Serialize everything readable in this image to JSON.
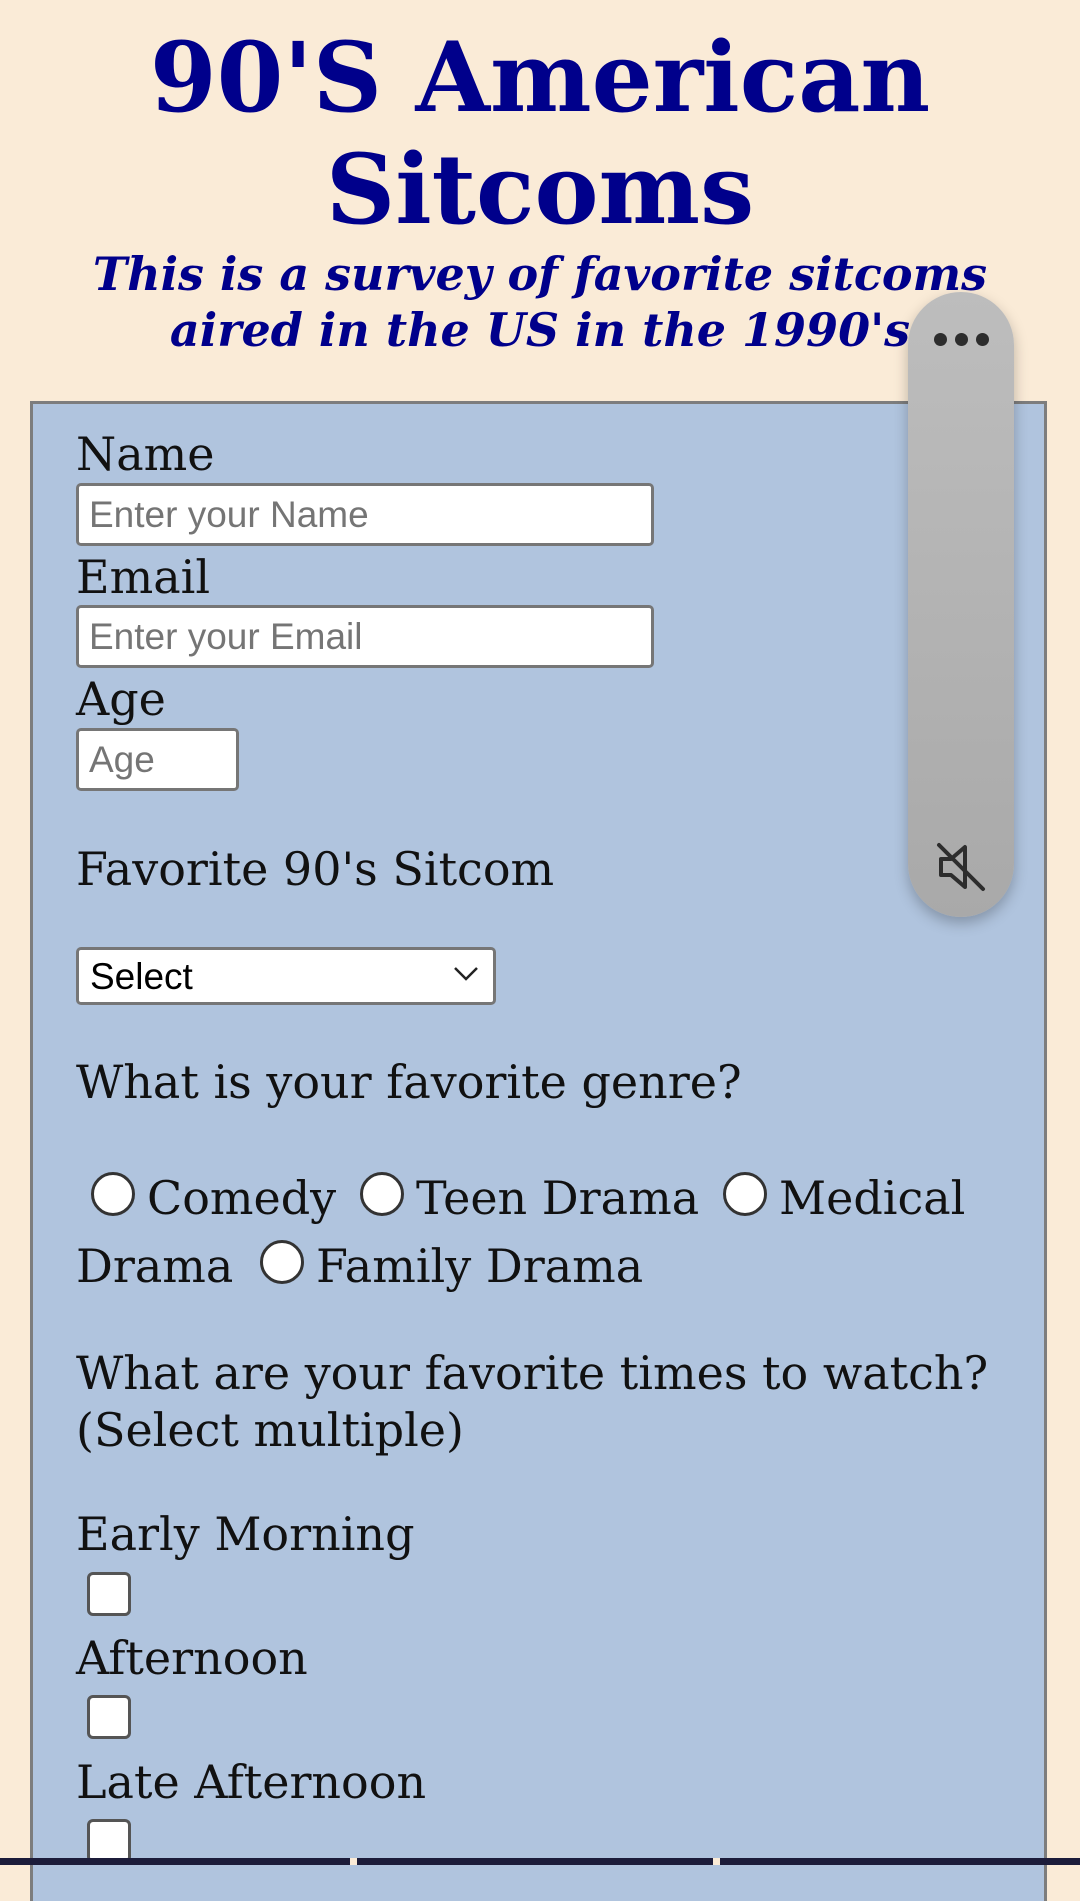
{
  "header": {
    "title": "90'S American Sitcoms",
    "subtitle": "This is a survey of favorite sitcoms aired in the US in the 1990's"
  },
  "form": {
    "name": {
      "label": "Name",
      "placeholder": "Enter your Name",
      "value": ""
    },
    "email": {
      "label": "Email",
      "placeholder": "Enter your Email",
      "value": ""
    },
    "age": {
      "label": "Age",
      "placeholder": "Age",
      "value": ""
    },
    "sitcom": {
      "label": "Favorite 90's Sitcom",
      "selected": "Select"
    },
    "genre": {
      "question": "What is your favorite genre?",
      "options": [
        "Comedy",
        "Teen Drama",
        "Medical",
        "Drama",
        "Family Drama"
      ]
    },
    "times": {
      "question_line1": "What are your favorite times to watch?",
      "question_line2": "(Select multiple)",
      "options": [
        "Early Morning",
        "Afternoon",
        "Late Afternoon"
      ]
    }
  },
  "overlay": {
    "more_icon": "more-horizontal-icon",
    "mute_icon": "volume-muted-icon"
  },
  "colors": {
    "page_background": "#faebd7",
    "heading": "#00008b",
    "form_background": "#b0c4de"
  }
}
